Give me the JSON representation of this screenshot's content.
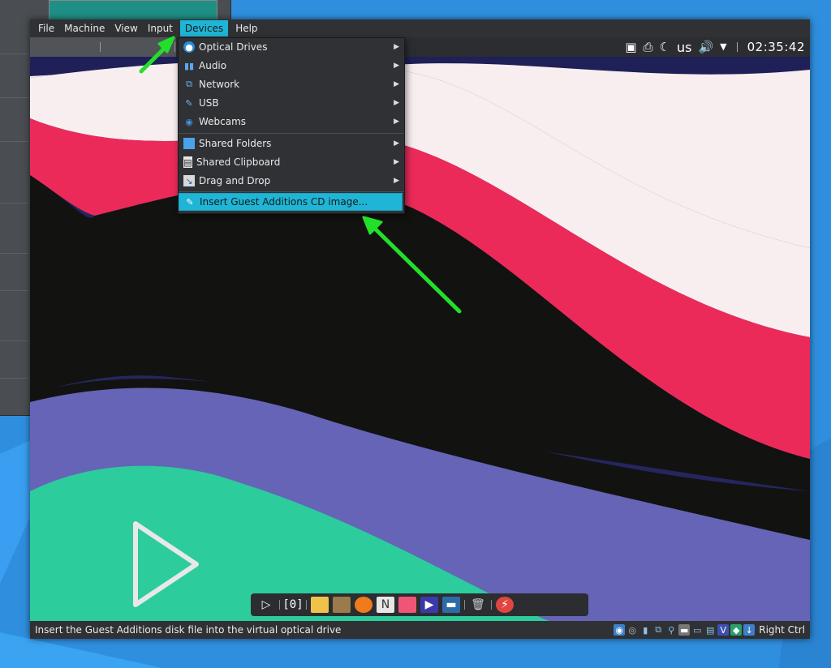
{
  "menubar": {
    "items": [
      {
        "label": "File"
      },
      {
        "label": "Machine"
      },
      {
        "label": "View"
      },
      {
        "label": "Input"
      },
      {
        "label": "Devices",
        "active": true
      },
      {
        "label": "Help"
      }
    ]
  },
  "devices_menu": {
    "items": [
      {
        "label": "Optical Drives",
        "icon": "optical-disc-icon",
        "submenu": true
      },
      {
        "label": "Audio",
        "icon": "audio-icon",
        "submenu": true
      },
      {
        "label": "Network",
        "icon": "network-icon",
        "submenu": true
      },
      {
        "label": "USB",
        "icon": "usb-icon",
        "submenu": true
      },
      {
        "label": "Webcams",
        "icon": "webcam-icon",
        "submenu": true
      },
      {
        "label": "Shared Folders",
        "icon": "folder-icon",
        "submenu": true
      },
      {
        "label": "Shared Clipboard",
        "icon": "clipboard-icon",
        "submenu": true
      },
      {
        "label": "Drag and Drop",
        "icon": "drag-drop-icon",
        "submenu": true
      },
      {
        "label": "Insert Guest Additions CD image...",
        "icon": "cd-insert-icon",
        "submenu": false,
        "highlighted": true
      }
    ]
  },
  "guest_panel": {
    "keyboard_layout": "us",
    "clock": "02:35:42"
  },
  "statusbar": {
    "message": "Insert the Guest Additions disk file into the virtual optical drive",
    "host_key": "Right Ctrl"
  },
  "colors": {
    "accent": "#1fb5d6",
    "annotation_arrow": "#22e02a",
    "wall_pink": "#ec2a5a",
    "wall_cream": "#f8eef0",
    "wall_navy": "#25265f",
    "wall_purple": "#6564b6",
    "wall_teal": "#2ccc9d",
    "wall_black": "#121210"
  }
}
